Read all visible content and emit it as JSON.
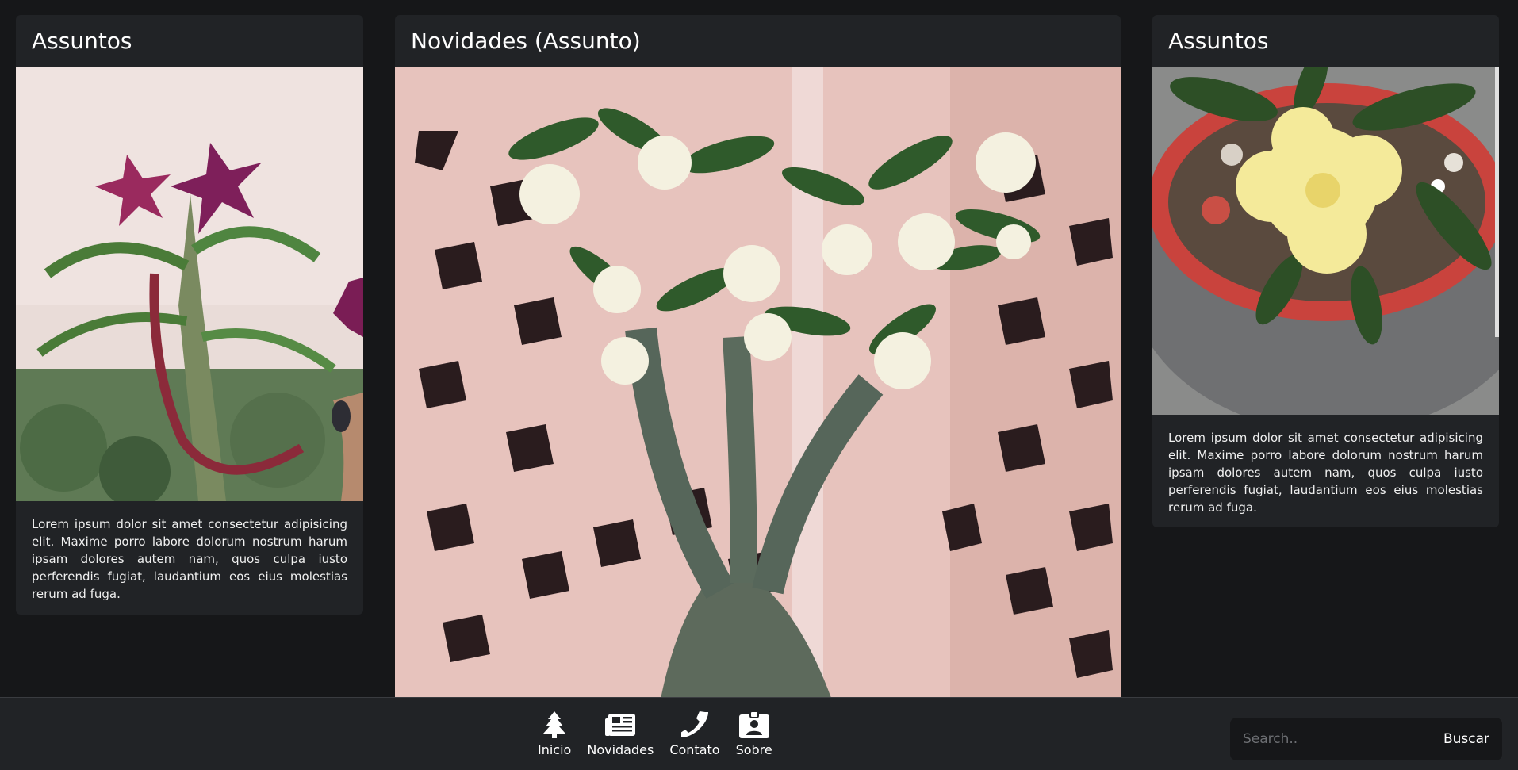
{
  "cards": {
    "left": {
      "title": "Assuntos",
      "image_alt": "Adenium flower with purple-red petals and seed pods",
      "text": "Lorem ipsum dolor sit amet consectetur adipisicing elit. Maxime porro labore dolorum nostrum harum ipsam dolores autem nam, quos culpa iusto perferendis fugiat, laudantium eos eius molestias rerum ad fuga."
    },
    "center": {
      "title": "Novidades (Assunto)",
      "image_alt": "Adenium plant with white flowers in front of pink lattice wall"
    },
    "right": {
      "title": "Assuntos",
      "image_alt": "Yellow adenium flower in a red and grey pot",
      "text": "Lorem ipsum dolor sit amet consectetur adipisicing elit. Maxime porro labore dolorum nostrum harum ipsam dolores autem nam, quos culpa iusto perferendis fugiat, laudantium eos eius molestias rerum ad fuga."
    }
  },
  "nav": {
    "items": [
      {
        "label": "Inicio",
        "icon": "tree-icon"
      },
      {
        "label": "Novidades",
        "icon": "newspaper-icon"
      },
      {
        "label": "Contato",
        "icon": "phone-icon"
      },
      {
        "label": "Sobre",
        "icon": "id-badge-icon"
      }
    ]
  },
  "search": {
    "placeholder": "Search..",
    "button_label": "Buscar"
  }
}
